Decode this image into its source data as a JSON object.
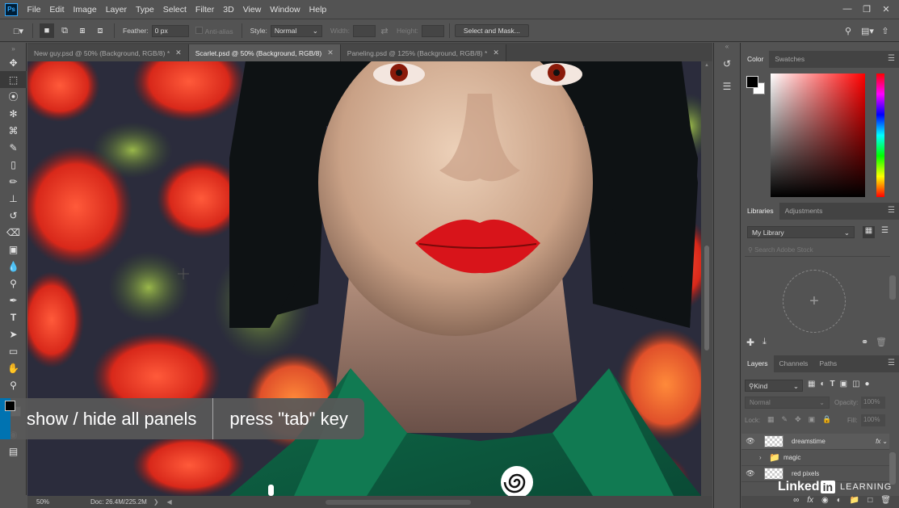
{
  "app": {
    "logo": "Ps"
  },
  "menu": [
    "File",
    "Edit",
    "Image",
    "Layer",
    "Type",
    "Select",
    "Filter",
    "3D",
    "View",
    "Window",
    "Help"
  ],
  "options": {
    "feather_label": "Feather:",
    "feather_value": "0 px",
    "antialias_label": "Anti-alias",
    "style_label": "Style:",
    "style_value": "Normal",
    "width_label": "Width:",
    "height_label": "Height:",
    "select_mask_label": "Select and Mask..."
  },
  "tabs": [
    {
      "label": "New guy.psd @ 50% (Background, RGB/8) *"
    },
    {
      "label": "Scarlet.psd @ 50% (Background, RGB/8)"
    },
    {
      "label": "Paneling.psd @ 125% (Background, RGB/8) *"
    }
  ],
  "status": {
    "zoom": "50%",
    "doc": "Doc: 26.4M/225.2M"
  },
  "color_panel": {
    "tabs": [
      "Color",
      "Swatches"
    ],
    "foreground": "#000000",
    "background": "#ffffff"
  },
  "libraries_panel": {
    "tabs": [
      "Libraries",
      "Adjustments"
    ],
    "library_name": "My Library",
    "search_placeholder": "Search Adobe Stock"
  },
  "layers_panel": {
    "tabs": [
      "Layers",
      "Channels",
      "Paths"
    ],
    "kind_label": "Kind",
    "blend_mode": "Normal",
    "opacity_label": "Opacity:",
    "opacity_value": "100%",
    "lock_label": "Lock:",
    "fill_label": "Fill:",
    "fill_value": "100%",
    "layers": [
      {
        "name": "dreamstime",
        "type": "layer",
        "fx": "fx"
      },
      {
        "name": "magic",
        "type": "group"
      },
      {
        "name": "red pixels",
        "type": "layer"
      }
    ]
  },
  "overlay": {
    "left": "show / hide all panels",
    "right": "press \"tab\" key"
  },
  "watermark": {
    "brand": "Linked",
    "in": "in",
    "learning": "LEARNING"
  }
}
